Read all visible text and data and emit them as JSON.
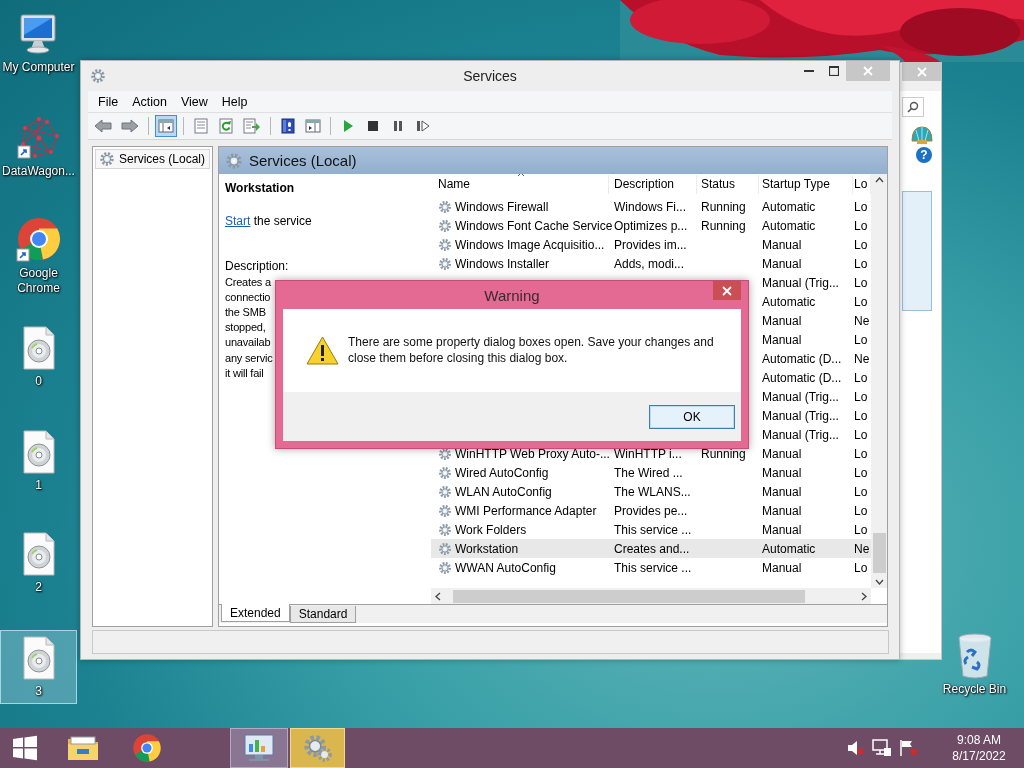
{
  "desktop_icons": [
    {
      "label": "My Computer",
      "kind": "computer",
      "selected": false
    },
    {
      "label": "DataWagon...",
      "kind": "network-shortcut",
      "selected": false
    },
    {
      "label": "Google Chrome",
      "kind": "chrome-shortcut",
      "selected": false
    },
    {
      "label": "0",
      "kind": "disc-file",
      "selected": false
    },
    {
      "label": "1",
      "kind": "disc-file",
      "selected": false
    },
    {
      "label": "2",
      "kind": "disc-file",
      "selected": false
    },
    {
      "label": "3",
      "kind": "disc-file",
      "selected": true
    },
    {
      "label": "Recycle Bin",
      "kind": "recycle-bin",
      "selected": false
    }
  ],
  "background_window": {
    "help_mark": "?"
  },
  "services_window": {
    "title": "Services",
    "menu": [
      "File",
      "Action",
      "View",
      "Help"
    ],
    "toolbar": [
      {
        "kind": "back",
        "pressed": false
      },
      {
        "kind": "forward",
        "pressed": false
      },
      {
        "kind": "separator"
      },
      {
        "kind": "console-tree",
        "pressed": true
      },
      {
        "kind": "separator"
      },
      {
        "kind": "properties",
        "pressed": false
      },
      {
        "kind": "refresh",
        "pressed": false
      },
      {
        "kind": "export",
        "pressed": false
      },
      {
        "kind": "separator"
      },
      {
        "kind": "help",
        "pressed": false
      },
      {
        "kind": "action-pane",
        "pressed": false
      },
      {
        "kind": "separator"
      },
      {
        "kind": "start",
        "pressed": false
      },
      {
        "kind": "stop",
        "pressed": false
      },
      {
        "kind": "pause",
        "pressed": false
      },
      {
        "kind": "resume",
        "pressed": false
      }
    ],
    "tree": [
      {
        "label": "Services (Local)",
        "selected": true
      }
    ],
    "pane_title": "Services (Local)",
    "details": {
      "service_name": "Workstation",
      "action_link": "Start",
      "action_text": "the service",
      "description_label": "Description:",
      "description_lines": [
        "Creates a",
        "connectio",
        "the SMB",
        "stopped,",
        "unavailab",
        "any servic",
        "it will fail"
      ]
    },
    "columns": [
      "Name",
      "Description",
      "Status",
      "Startup Type",
      "Lo"
    ],
    "rows": [
      {
        "name": "Windows Firewall",
        "description": "Windows Fi...",
        "status": "Running",
        "startup_type": "Automatic",
        "log_on_as": "Lo",
        "selected": false
      },
      {
        "name": "Windows Font Cache Service",
        "description": "Optimizes p...",
        "status": "Running",
        "startup_type": "Automatic",
        "log_on_as": "Lo",
        "selected": false
      },
      {
        "name": "Windows Image Acquisitio...",
        "description": "Provides im...",
        "startup_type": "Manual",
        "log_on_as": "Lo",
        "selected": false
      },
      {
        "name": "Windows Installer",
        "description": "Adds, modi...",
        "startup_type": "Manual",
        "log_on_as": "Lo",
        "selected": false
      },
      {
        "startup_type": "Manual (Trig...",
        "log_on_as": "Lo",
        "selected": false
      },
      {
        "startup_type": "Automatic",
        "log_on_as": "Lo",
        "selected": false
      },
      {
        "startup_type": "Manual",
        "log_on_as": "Ne",
        "selected": false
      },
      {
        "startup_type": "Manual",
        "log_on_as": "Lo",
        "selected": false
      },
      {
        "startup_type": "Automatic (D...",
        "log_on_as": "Ne",
        "selected": false
      },
      {
        "startup_type": "Automatic (D...",
        "log_on_as": "Lo",
        "selected": false
      },
      {
        "startup_type": "Manual (Trig...",
        "log_on_as": "Lo",
        "selected": false
      },
      {
        "startup_type": "Manual (Trig...",
        "log_on_as": "Lo",
        "selected": false
      },
      {
        "startup_type": "Manual (Trig...",
        "log_on_as": "Lo",
        "selected": false
      },
      {
        "name": "WinHTTP Web Proxy Auto-...",
        "description": "WinHTTP i...",
        "status": "Running",
        "startup_type": "Manual",
        "log_on_as": "Lo",
        "selected": false
      },
      {
        "name": "Wired AutoConfig",
        "description": "The Wired ...",
        "startup_type": "Manual",
        "log_on_as": "Lo",
        "selected": false
      },
      {
        "name": "WLAN AutoConfig",
        "description": "The WLANS...",
        "startup_type": "Manual",
        "log_on_as": "Lo",
        "selected": false
      },
      {
        "name": "WMI Performance Adapter",
        "description": "Provides pe...",
        "startup_type": "Manual",
        "log_on_as": "Lo",
        "selected": false
      },
      {
        "name": "Work Folders",
        "description": "This service ...",
        "startup_type": "Manual",
        "log_on_as": "Lo",
        "selected": false
      },
      {
        "name": "Workstation",
        "description": "Creates and...",
        "startup_type": "Automatic",
        "log_on_as": "Ne",
        "selected": true
      },
      {
        "name": "WWAN AutoConfig",
        "description": "This service ...",
        "startup_type": "Manual",
        "log_on_as": "Lo",
        "selected": false
      }
    ],
    "tabs": [
      {
        "label": "Extended",
        "selected": true
      },
      {
        "label": "Standard",
        "selected": false
      }
    ]
  },
  "warning_dialog": {
    "title": "Warning",
    "message": "There are some property dialog boxes open. Save your changes and close them before closing this dialog box.",
    "buttons": [
      "OK"
    ]
  },
  "taskbar": {
    "buttons": [
      {
        "kind": "start",
        "open": false,
        "selected": false
      },
      {
        "kind": "file-explorer",
        "open": false,
        "selected": false
      },
      {
        "kind": "chrome",
        "open": false,
        "selected": false
      },
      {
        "kind": "control-panel",
        "open": true,
        "selected": false
      },
      {
        "kind": "services",
        "open": true,
        "selected": true
      }
    ],
    "tray": [
      {
        "kind": "speaker-muted"
      },
      {
        "kind": "network"
      },
      {
        "kind": "flag"
      }
    ],
    "clock": {
      "time": "9:08 AM",
      "date": "8/17/2022"
    }
  }
}
